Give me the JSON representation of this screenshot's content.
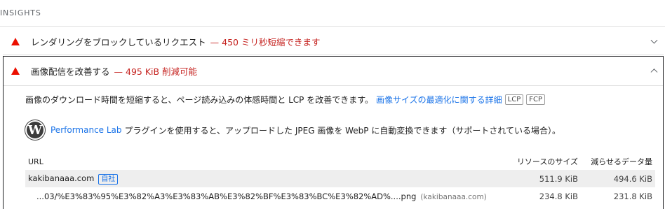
{
  "section": {
    "title": "INSIGHTS"
  },
  "audits": [
    {
      "title": "レンダリングをブロックしているリクエスト",
      "savings": "— 450 ミリ秒短縮できます"
    },
    {
      "title": "画像配信を改善する",
      "savings": "— 495 KiB 削減可能"
    }
  ],
  "detail": {
    "description": "画像のダウンロード時間を短縮すると、ページ読み込みの体感時間と LCP を改善できます。",
    "link": "画像サイズの最適化に関する詳細",
    "tags": [
      "LCP",
      "FCP"
    ],
    "plugin_link": "Performance Lab",
    "plugin_text": "プラグインを使用すると、アップロードした JPEG 画像を WebP に自動変換できます（サポートされている場合）。",
    "wp_icon": "W",
    "table": {
      "headers": [
        "URL",
        "リソースのサイズ",
        "減らせるデータ量"
      ],
      "group": {
        "host": "kakibanaaa.com",
        "badge": "自社",
        "size": "511.9 KiB",
        "savings": "494.6 KiB"
      },
      "item": {
        "url": "...03/%E3%83%95%E3%82%A3%E3%83%AB%E3%82%BF%E3%83%BC%E3%82%AD%....png",
        "host": "(kakibanaaa.com)",
        "size": "234.8 KiB",
        "savings": "231.8 KiB"
      }
    }
  },
  "colors": {
    "fail": "#eb0f00",
    "savings": "#c5221f",
    "link": "#1a73e8"
  }
}
